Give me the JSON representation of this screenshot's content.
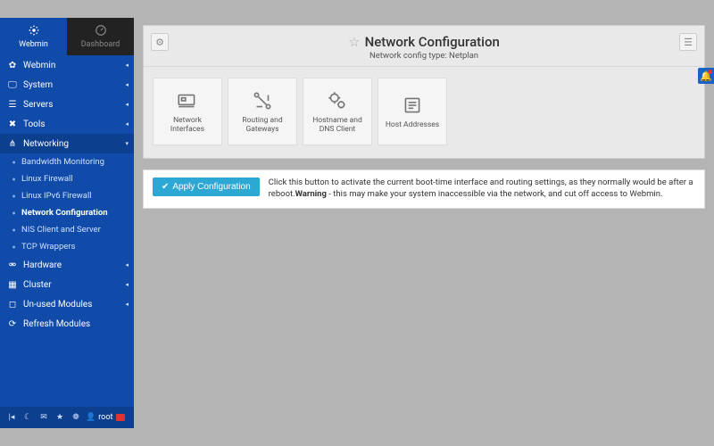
{
  "tabs": {
    "webmin": "Webmin",
    "dashboard": "Dashboard"
  },
  "sidebar": {
    "sections": [
      {
        "label": "Webmin"
      },
      {
        "label": "System"
      },
      {
        "label": "Servers"
      },
      {
        "label": "Tools"
      },
      {
        "label": "Networking"
      },
      {
        "label": "Hardware"
      },
      {
        "label": "Cluster"
      },
      {
        "label": "Un-used Modules"
      },
      {
        "label": "Refresh Modules"
      }
    ],
    "networking_items": [
      {
        "label": "Bandwidth Monitoring"
      },
      {
        "label": "Linux Firewall"
      },
      {
        "label": "Linux IPv6 Firewall"
      },
      {
        "label": "Network Configuration"
      },
      {
        "label": "NIS Client and Server"
      },
      {
        "label": "TCP Wrappers"
      }
    ],
    "user_label": "root"
  },
  "header": {
    "title": "Network Configuration",
    "subtitle": "Network config type: Netplan"
  },
  "cards": [
    {
      "label": "Network Interfaces"
    },
    {
      "label": "Routing and Gateways"
    },
    {
      "label": "Hostname and DNS Client"
    },
    {
      "label": "Host Addresses"
    }
  ],
  "apply": {
    "button": "Apply Configuration",
    "text_pre": "Click this button to activate the current boot-time interface and routing settings, as they normally would be after a reboot.",
    "warning_label": "Warning",
    "text_post": " - this may make your system inaccessible via the network, and cut off access to Webmin."
  }
}
